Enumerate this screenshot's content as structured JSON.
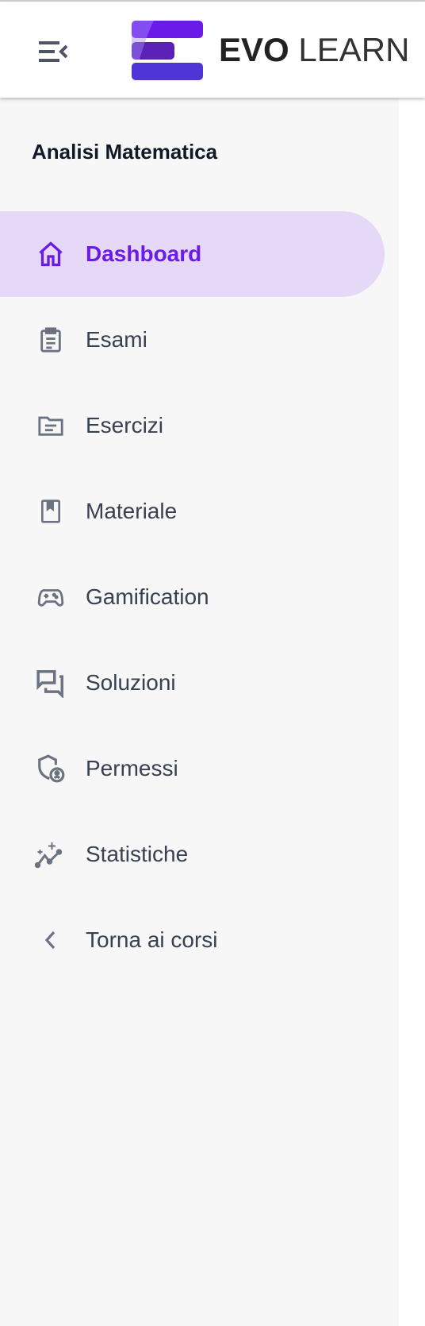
{
  "header": {
    "brand_bold": "EVO",
    "brand_light": "LEARN"
  },
  "sidebar": {
    "course_title": "Analisi Matematica",
    "items": [
      {
        "label": "Dashboard",
        "icon": "home-icon",
        "active": true
      },
      {
        "label": "Esami",
        "icon": "clipboard-icon"
      },
      {
        "label": "Esercizi",
        "icon": "folder-icon"
      },
      {
        "label": "Materiale",
        "icon": "book-icon"
      },
      {
        "label": "Gamification",
        "icon": "gamepad-icon"
      },
      {
        "label": "Soluzioni",
        "icon": "chat-bubbles-icon"
      },
      {
        "label": "Permessi",
        "icon": "shield-user-icon"
      },
      {
        "label": "Statistiche",
        "icon": "sparkle-chart-icon"
      },
      {
        "label": "Torna ai corsi",
        "icon": "chevron-left-icon"
      }
    ]
  },
  "colors": {
    "accent": "#6a1be6",
    "active_bg": "#e6d8f7",
    "sidebar_bg": "#f7f7f7",
    "icon": "#6b7280"
  }
}
